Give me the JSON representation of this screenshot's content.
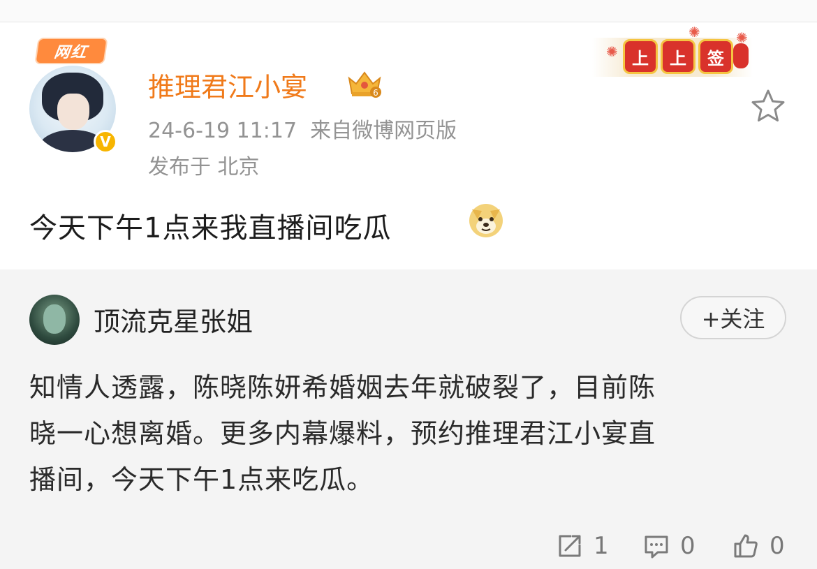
{
  "post": {
    "badge_label": "网红",
    "username": "推理君江小宴",
    "level": "6",
    "verified_mark": "V",
    "timestamp": "24-6-19 11:17",
    "source": "来自微博网页版",
    "location": "发布于 北京",
    "text": "今天下午1点来我直播间吃瓜",
    "emoji": "doge-emoji",
    "sign_banner": [
      "上",
      "上",
      "签"
    ]
  },
  "repost": {
    "username": "顶流克星张姐",
    "follow_label": "+关注",
    "lines": [
      "知情人透露，陈晓陈妍希婚姻去年就破裂了，目前陈",
      "晓一心想离婚。更多内幕爆料，预约推理君江小宴直",
      "播间，今天下午1点来吃瓜。"
    ],
    "reposts": "1",
    "comments": "0",
    "likes": "0"
  },
  "colors": {
    "username_orange": "#f07a1a",
    "meta_gray": "#939393",
    "repost_bg": "#f4f4f4",
    "verified_gold": "#f7b500"
  }
}
